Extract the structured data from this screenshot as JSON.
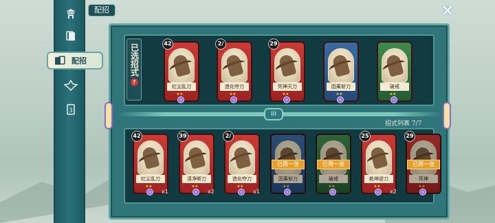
{
  "header": {
    "title": "配招",
    "close_icon": "close-icon"
  },
  "sidebar": {
    "items": [
      {
        "icon": "pagoda-icon"
      },
      {
        "icon": "card-deck-icon"
      },
      {
        "icon": "card-hand-icon",
        "label": "配招",
        "active": true
      },
      {
        "icon": "crest-icon"
      },
      {
        "icon": "scroll-card-icon"
      }
    ]
  },
  "selected": {
    "label": "已选招式",
    "help": "?",
    "cards": [
      {
        "cost": "42",
        "name": "红尘乱刀",
        "color": "red"
      },
      {
        "cost": "2/",
        "name": "造化夺刀",
        "color": "red"
      },
      {
        "cost": "29",
        "name": "死神灭刀",
        "color": "red"
      },
      {
        "cost": "",
        "name": "因果斩刀",
        "color": "blue"
      },
      {
        "cost": "",
        "name": "破戒",
        "color": "green"
      }
    ]
  },
  "divider": {
    "tab": "III"
  },
  "list": {
    "label": "招式列表 7/7",
    "used_text": "已用一张",
    "cards": [
      {
        "cost": "42",
        "name": "红尘乱刀",
        "count": "x1",
        "color": "red",
        "used": false
      },
      {
        "cost": "39",
        "name": "清净断刀",
        "count": "x2",
        "color": "red",
        "used": false
      },
      {
        "cost": "2/",
        "name": "造化夺刀",
        "count": "x1",
        "color": "red",
        "used": false
      },
      {
        "cost": "",
        "name": "因果斩刀",
        "count": "",
        "color": "blue",
        "used": true
      },
      {
        "cost": "",
        "name": "破戒",
        "count": "",
        "color": "green",
        "used": true
      },
      {
        "cost": "25",
        "name": "乾坤逆刀",
        "count": "x2",
        "color": "red",
        "used": false
      },
      {
        "cost": "29",
        "name": "死神",
        "count": "",
        "color": "red",
        "used": true
      }
    ]
  }
}
